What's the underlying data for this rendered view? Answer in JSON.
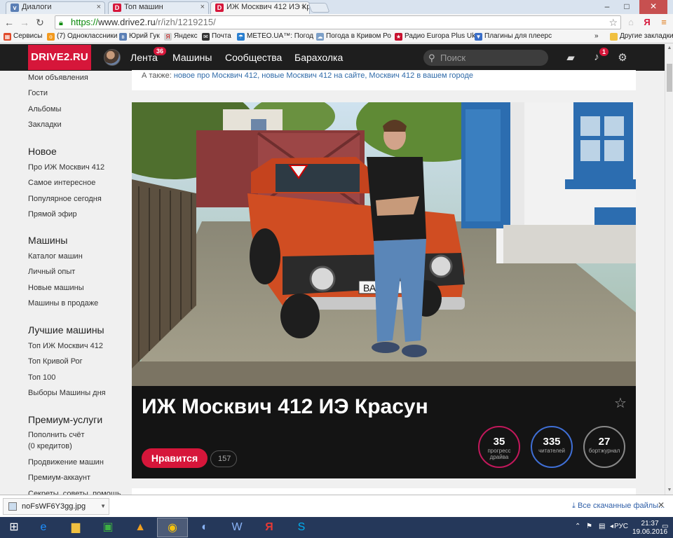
{
  "browser": {
    "tabs": [
      {
        "label": "Диалоги",
        "favicon_color": "#5b7fb5",
        "favicon": "v"
      },
      {
        "label": "Топ машин",
        "favicon_color": "#d6163a",
        "favicon": "D"
      },
      {
        "label": "ИЖ Москвич 412 ИЭ Кра",
        "favicon_color": "#d6163a",
        "favicon": "D",
        "active": true
      }
    ],
    "url_scheme": "https://",
    "url_host": "www.drive2.ru",
    "url_path": "/r/izh/1219215/",
    "bookmarks": [
      {
        "label": "Сервисы",
        "color": "#e04a2a",
        "icon": "▦"
      },
      {
        "label": "(7) Одноклассники",
        "color": "#f39a1e",
        "icon": "о"
      },
      {
        "label": "Юрий Гук",
        "color": "#5b7fb5",
        "icon": "в"
      },
      {
        "label": "Яндекс",
        "color": "#d0d0d0",
        "icon": "Я"
      },
      {
        "label": "Почта",
        "color": "#333",
        "icon": "✉"
      },
      {
        "label": "METEO.UA™: Погод",
        "color": "#2a7fd0",
        "icon": "☂"
      },
      {
        "label": "Погода в Кривом Ро",
        "color": "#7da0c8",
        "icon": "☁"
      },
      {
        "label": "Радио Europa Plus Uk",
        "color": "#c8102e",
        "icon": "★"
      },
      {
        "label": "Плагины для плеерс",
        "color": "#3a6ec8",
        "icon": "▼"
      }
    ],
    "bookmarks_more": "»",
    "other_bookmarks": "Другие закладки"
  },
  "site": {
    "logo": "DRIVE2.RU",
    "nav": [
      {
        "label": "Лента"
      },
      {
        "label": "Машины"
      },
      {
        "label": "Сообщества"
      },
      {
        "label": "Барахолка"
      }
    ],
    "feed_badge": "36",
    "search_placeholder": "Поиск",
    "notif_badge": "1",
    "accent_color": "#d6163a"
  },
  "sidebar": {
    "top_links": [
      "Мои объявления",
      "Гости",
      "Альбомы",
      "Закладки"
    ],
    "sections": [
      {
        "title": "Новое",
        "links": [
          "Про ИЖ Москвич 412",
          "Самое интересное",
          "Популярное сегодня",
          "Прямой эфир"
        ]
      },
      {
        "title": "Машины",
        "links": [
          "Каталог машин",
          "Личный опыт",
          "Новые машины",
          "Машины в продаже"
        ]
      },
      {
        "title": "Лучшие машины",
        "links": [
          "Топ ИЖ Москвич 412",
          "Топ Кривой Рог",
          "Топ 100",
          "Выборы Машины дня"
        ]
      },
      {
        "title": "Премиум-услуги",
        "links": [
          "Пополнить счёт",
          "(0 кредитов)",
          "Продвижение машин",
          "Премиум-аккаунт",
          "Секреты, советы, помощь"
        ]
      }
    ]
  },
  "content": {
    "also_prefix": "А также:",
    "also_links": "новое про Москвич 412, новые Москвич 412 на сайте, Москвич 412 в вашем городе",
    "car_title": "ИЖ Москвич 412 ИЭ Красун",
    "plate_text": "ВА",
    "like_label": "Нравится",
    "like_count": "157",
    "stats": [
      {
        "value": "35",
        "label": "прогресс драйва",
        "color": "#c2185b"
      },
      {
        "value": "335",
        "label": "читателей",
        "color": "#3f6fd6"
      },
      {
        "value": "27",
        "label": "бортжурнал",
        "color": "#888888"
      }
    ]
  },
  "downloads": {
    "file": "noFsWF6Y3gg.jpg",
    "all_label": "Все скачанные файлы..."
  },
  "taskbar": {
    "lang": "РУС",
    "time": "21:37",
    "date": "19.06.2016"
  }
}
